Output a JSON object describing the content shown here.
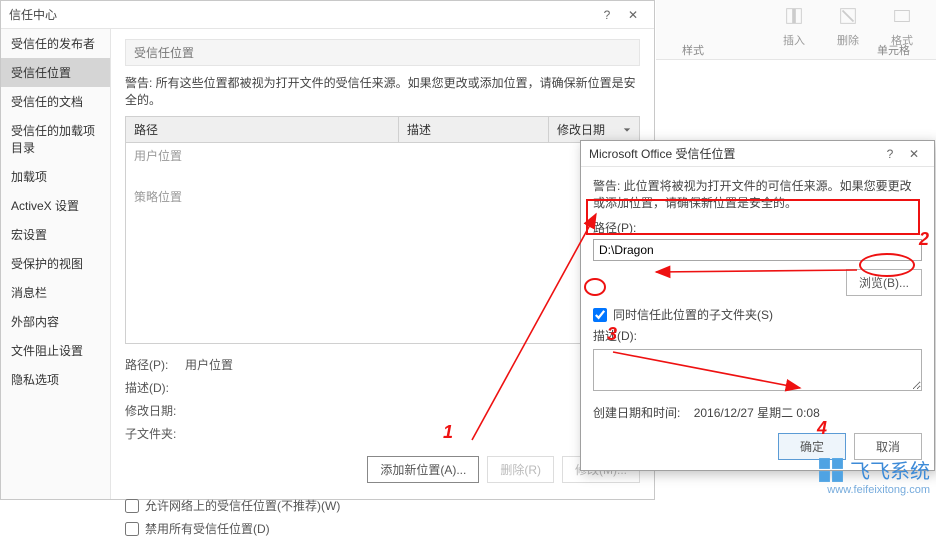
{
  "trust_center": {
    "title": "信任中心",
    "sidebar": [
      "受信任的发布者",
      "受信任位置",
      "受信任的文档",
      "受信任的加载项目录",
      "加载项",
      "ActiveX 设置",
      "宏设置",
      "受保护的视图",
      "消息栏",
      "外部内容",
      "文件阻止设置",
      "隐私选项"
    ],
    "section_title": "受信任位置",
    "warning": "警告: 所有这些位置都被视为打开文件的受信任来源。如果您更改或添加位置，请确保新位置是安全的。",
    "headers": {
      "path": "路径",
      "desc": "描述",
      "date": "修改日期"
    },
    "rows": {
      "user_loc": "用户位置",
      "policy_loc": "策略位置"
    },
    "details": {
      "path_label": "路径(P):",
      "path_val": "用户位置",
      "desc_label": "描述(D):",
      "date_label": "修改日期:",
      "sub_label": "子文件夹:"
    },
    "buttons": {
      "add": "添加新位置(A)...",
      "remove": "删除(R)",
      "modify": "修改(M)..."
    },
    "checks": {
      "allow_network": "允许网络上的受信任位置(不推荐)(W)",
      "disable_all": "禁用所有受信任位置(D)"
    }
  },
  "dialog": {
    "title": "Microsoft Office 受信任位置",
    "warning": "警告: 此位置将被视为打开文件的可信任来源。如果您要更改或添加位置，请确保新位置是安全的。",
    "path_label": "路径(P):",
    "path_value": "D:\\Dragon",
    "browse": "浏览(B)...",
    "trust_sub": "同时信任此位置的子文件夹(S)",
    "desc_label": "描述(D):",
    "meta_label": "创建日期和时间:",
    "meta_value": "2016/12/27  星期二  0:08",
    "ok": "确定",
    "cancel": "取消"
  },
  "ribbon": {
    "insert": "插入",
    "delete": "删除",
    "format": "格式",
    "style": "样式",
    "cells": "单元格"
  },
  "watermark": {
    "brand": "飞飞系统",
    "url": "www.feifeixitong.com"
  },
  "anno": {
    "n1": "1",
    "n2": "2",
    "n3": "3",
    "n4": "4"
  }
}
